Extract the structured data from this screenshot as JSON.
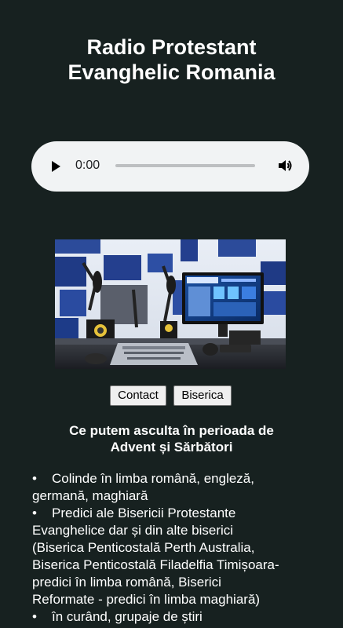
{
  "header": {
    "title_line1": "Radio Protestant",
    "title_line2": "Evanghelic Romania"
  },
  "player": {
    "current_time": "0:00",
    "progress": 0,
    "play_icon": "play-icon",
    "volume_icon": "volume-icon"
  },
  "buttons": {
    "contact_label": "Contact",
    "biserica_label": "Biserica"
  },
  "section": {
    "heading_line1": "Ce putem asculta în perioada de",
    "heading_line2": "Advent și Sărbători"
  },
  "list": {
    "bullet": "•",
    "items": [
      {
        "line1": "Colinde în limba română, engleză,",
        "rest": [
          "germană, maghiară"
        ]
      },
      {
        "line1": "Predici ale Bisericii Protestante",
        "rest": [
          "Evanghelice dar și din alte biserici",
          "(Biserica Penticostală Perth Australia,",
          "Biserica Penticostală Filadelfia Timișoara-",
          "predici în limba română, Biserici",
          "Reformate - predici în limba maghiară)"
        ]
      },
      {
        "line1": "în curând, grupaje de știri",
        "rest": []
      }
    ]
  },
  "colors": {
    "background": "#172120",
    "player_bg": "#f1f3f4",
    "text": "#ffffff"
  }
}
